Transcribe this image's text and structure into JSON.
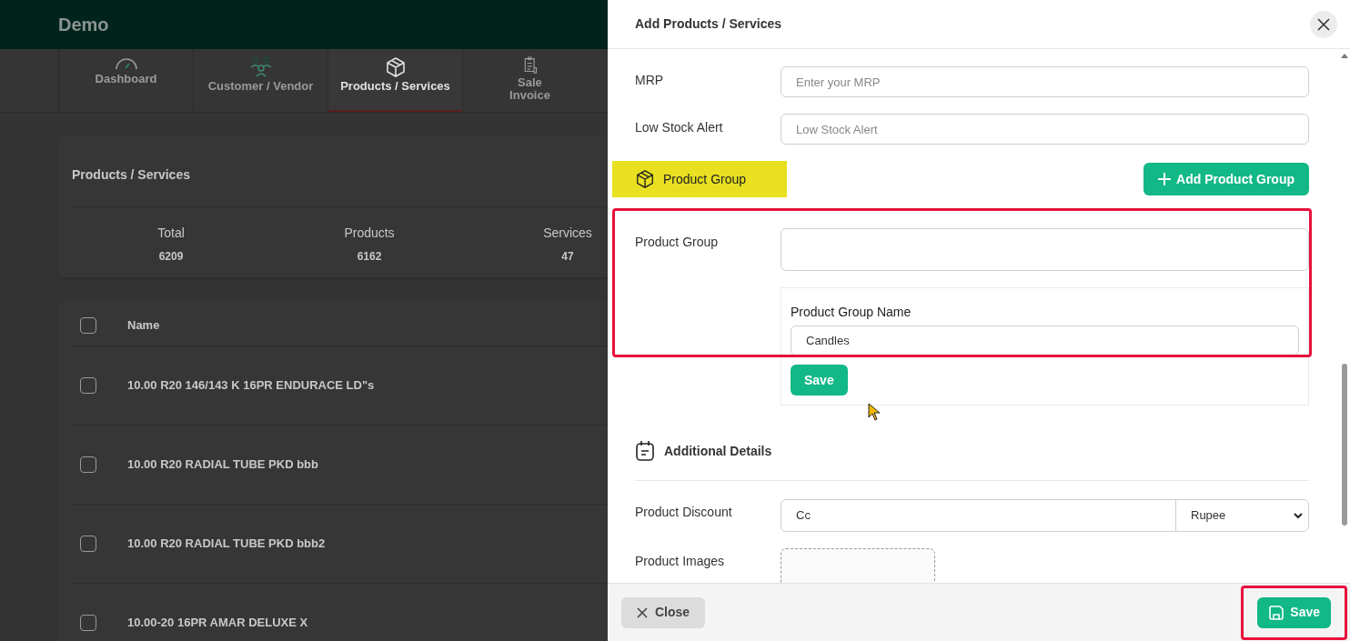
{
  "app": {
    "brand": "Demo"
  },
  "nav_tabs": [
    {
      "label": "Dashboard",
      "selected": false
    },
    {
      "label": "Customer / Vendor",
      "selected": false
    },
    {
      "label": "Products / Services",
      "selected": true
    },
    {
      "label": "Sale\nInvoice",
      "selected": false
    }
  ],
  "summary": {
    "title": "Products / Services",
    "stats": [
      {
        "label": "Total",
        "value": "6209"
      },
      {
        "label": "Products",
        "value": "6162"
      },
      {
        "label": "Services",
        "value": "47"
      }
    ]
  },
  "table": {
    "columns": [
      "Name"
    ],
    "header_checked": false,
    "rows": [
      {
        "name": "10.00 R20 146/143 K 16PR ENDURACE LD\"s",
        "checked": false
      },
      {
        "name": "10.00 R20 RADIAL TUBE PKD bbb",
        "checked": false
      },
      {
        "name": "10.00 R20 RADIAL TUBE PKD bbb2",
        "checked": false
      },
      {
        "name": "10.00-20 16PR AMAR DELUXE X",
        "checked": false
      }
    ]
  },
  "drawer": {
    "title": "Add Products / Services",
    "fields": [
      {
        "label": "MRP",
        "placeholder": "Enter your MRP"
      },
      {
        "label": "Low Stock Alert",
        "placeholder": "Low Stock Alert"
      }
    ],
    "product_group_section": {
      "title": "Product Group",
      "highlighted": true,
      "add_button": "Add Product Group"
    },
    "product_group": {
      "label": "Product Group",
      "annotated": true,
      "new_group": {
        "label": "Product Group Name",
        "value": "Candles",
        "save_button": "Save"
      }
    },
    "additional_details": {
      "title": "Additional Details",
      "discount": {
        "label": "Product Discount",
        "value": "Cc",
        "unit": "Rupee"
      },
      "images": {
        "label": "Product Images"
      }
    },
    "footer": {
      "close_button": "Close",
      "save_button": "Save",
      "save_annotated": true
    }
  }
}
